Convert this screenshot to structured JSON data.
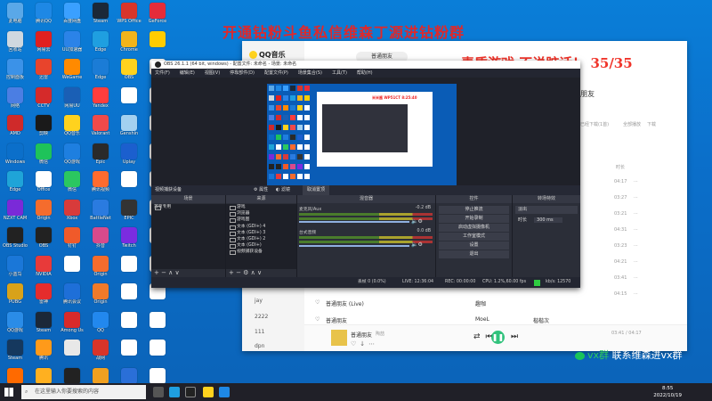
{
  "desktop_icons": [
    {
      "label": "此电脑",
      "color": "#5aa8e8"
    },
    {
      "label": "腾讯QQ",
      "color": "#1e88e5"
    },
    {
      "label": "百度网盘",
      "color": "#3aa0ff"
    },
    {
      "label": "Steam",
      "color": "#1b2838"
    },
    {
      "label": "WPS Office",
      "color": "#d8352a"
    },
    {
      "label": "GeForce",
      "color": "#e52c3a"
    },
    {
      "label": "回收站",
      "color": "#cfd8e0"
    },
    {
      "label": "网易云",
      "color": "#e02020"
    },
    {
      "label": "UU加速器",
      "color": "#2b83e8"
    },
    {
      "label": "Edge",
      "color": "#1f9fe0"
    },
    {
      "label": "Chrome",
      "color": "#f2b41a"
    },
    {
      "label": "",
      "color": "#ffcc00"
    },
    {
      "label": "控制面板",
      "color": "#3b92e8"
    },
    {
      "label": "迅雷",
      "color": "#e8442c"
    },
    {
      "label": "WeGame",
      "color": "#ff8a00"
    },
    {
      "label": "Edge",
      "color": "#1b7cd6"
    },
    {
      "label": "OBS",
      "color": "#ffd21e"
    },
    {
      "label": "",
      "color": "#ffffff"
    },
    {
      "label": "网络",
      "color": "#4b7ee3"
    },
    {
      "label": "CCTV",
      "color": "#d52a2a"
    },
    {
      "label": "网易UU",
      "color": "#1a5fb5"
    },
    {
      "label": "Yandex",
      "color": "#ff3d3d"
    },
    {
      "label": "",
      "color": "#ffffff"
    },
    {
      "label": "",
      "color": "#ffffff"
    },
    {
      "label": "AMD",
      "color": "#cf2a2a"
    },
    {
      "label": "剪映",
      "color": "#1a1a1a"
    },
    {
      "label": "QQ音乐",
      "color": "#ffd21e"
    },
    {
      "label": "Valorant",
      "color": "#f04a4a"
    },
    {
      "label": "Genshin",
      "color": "#a3d0f0"
    },
    {
      "label": "",
      "color": "#ffffff"
    },
    {
      "label": "Windows",
      "color": "#0b6fca"
    },
    {
      "label": "微信",
      "color": "#1ec35a"
    },
    {
      "label": "QQ游戏",
      "color": "#1e7fe0"
    },
    {
      "label": "Epic",
      "color": "#2a2a2a"
    },
    {
      "label": "Uplay",
      "color": "#1b5fce"
    },
    {
      "label": "",
      "color": "#ffffff"
    },
    {
      "label": "Edge",
      "color": "#1fa4d8"
    },
    {
      "label": "Office",
      "color": "#ffffff"
    },
    {
      "label": "微信",
      "color": "#2bc760"
    },
    {
      "label": "腾讯视频",
      "color": "#ff6b2e"
    },
    {
      "label": "",
      "color": "#ffffff"
    },
    {
      "label": "",
      "color": "#ffffff"
    },
    {
      "label": "NZXT CAM",
      "color": "#7a2ad8"
    },
    {
      "label": "Origin",
      "color": "#f56c2d"
    },
    {
      "label": "Xbox",
      "color": "#d83b3b"
    },
    {
      "label": "BattleNet",
      "color": "#2a7be0"
    },
    {
      "label": "EPIC",
      "color": "#333333"
    },
    {
      "label": "",
      "color": "#ffffff"
    },
    {
      "label": "OBS Studio",
      "color": "#222222"
    },
    {
      "label": "OBS",
      "color": "#222222"
    },
    {
      "label": "钉钉",
      "color": "#f05a2a"
    },
    {
      "label": "抖音",
      "color": "#d84a8c"
    },
    {
      "label": "Twitch",
      "color": "#7b2ce0"
    },
    {
      "label": "",
      "color": "#ffffff"
    },
    {
      "label": "小蓝鸟",
      "color": "#1a77d8"
    },
    {
      "label": "NVIDIA",
      "color": "#e83a3a"
    },
    {
      "label": "",
      "color": "#ffffff"
    },
    {
      "label": "Origin",
      "color": "#f56c2d"
    },
    {
      "label": "",
      "color": "#ffffff"
    },
    {
      "label": "",
      "color": "#ffffff"
    },
    {
      "label": "PUBG",
      "color": "#d8a21a"
    },
    {
      "label": "雷神",
      "color": "#e52c2c"
    },
    {
      "label": "腾讯会议",
      "color": "#1e6fd8"
    },
    {
      "label": "Origin",
      "color": "#f07a2a"
    },
    {
      "label": "",
      "color": "#ffffff"
    },
    {
      "label": "",
      "color": "#ffffff"
    },
    {
      "label": "QQ游戏",
      "color": "#2a8ce8"
    },
    {
      "label": "Steam",
      "color": "#1b2838"
    },
    {
      "label": "Among Us",
      "color": "#d82a2a"
    },
    {
      "label": "QQ",
      "color": "#2288ee"
    },
    {
      "label": "",
      "color": "#ffffff"
    },
    {
      "label": "",
      "color": "#ffffff"
    },
    {
      "label": "Steam",
      "color": "#15385e"
    },
    {
      "label": "腾讯",
      "color": "#ff9a1a"
    },
    {
      "label": "",
      "color": "#e8e8e8"
    },
    {
      "label": "战网",
      "color": "#d8342a"
    },
    {
      "label": "",
      "color": "#ffffff"
    },
    {
      "label": "",
      "color": "#ffffff"
    },
    {
      "label": "暴雪",
      "color": "#ff6a00"
    },
    {
      "label": "WeGame",
      "color": "#ffb020"
    },
    {
      "label": "",
      "color": "#222222"
    },
    {
      "label": "",
      "color": "#f0a020"
    },
    {
      "label": "TeamSpeak",
      "color": "#2a6fd8"
    },
    {
      "label": "",
      "color": "#ffffff"
    }
  ],
  "banner": {
    "line1": "开通钻粉斗鱼私信维森丁源进钻粉群",
    "line2": "素质游戏 不说脏话！ 35/35"
  },
  "qq": {
    "logo": "QQ音乐",
    "tab": "普通朋友",
    "right_header": "朋友",
    "sidebar": [
      "jay",
      "2222",
      "111",
      "dpn"
    ],
    "header_right": [
      "已经下载(1首)",
      "全部播放",
      "下载"
    ],
    "col_time": "时长",
    "rows": [
      {
        "title": "普通朋友 (Live)",
        "artist": "趣咖",
        "time": "03:41"
      },
      {
        "title": "普通朋友",
        "artist": "MoeL",
        "album": "楷楷次",
        "time": "04:17"
      }
    ],
    "times": [
      "04:17",
      "03:27",
      "03:21",
      "04:31",
      "03:23",
      "04:21",
      "03:41",
      "04:15"
    ],
    "player": {
      "title": "普通朋友",
      "sub": "陶喆",
      "progress": "03:41 / 04:17"
    }
  },
  "obs": {
    "title": "OBS 26.1.1 (64 bit, windows) - 配置文件: 未命名 - 场景: 未命名",
    "menu": [
      "文件(F)",
      "编辑(E)",
      "视图(V)",
      "停靠部件(D)",
      "配置文件(P)",
      "场景集合(S)",
      "工具(T)",
      "帮助(H)"
    ],
    "source_line": [
      "视频捕获设备",
      "属性",
      "滤镜",
      "取消置顶"
    ],
    "scenes_h": "场景",
    "scenes": [
      "首页专用"
    ],
    "sources_h": "来源",
    "sources": [
      "游戏",
      "浏览器",
      "游戏图",
      "文本 (GDI+) 4",
      "文本 (GDI+) 3",
      "文本 (GDI+) 2",
      "文本 (GDI+)",
      "视频捕获设备"
    ],
    "mixer_h": "混音器",
    "ch1": "麦克风/Aux",
    "ch1_db": "-0.2 dB",
    "ch2": "台式音频",
    "ch2_db": "0.0 dB",
    "controls_h": "控件",
    "controls": [
      "停止推流",
      "开始录制",
      "启动虚拟摄像机",
      "工作室模式",
      "设置",
      "退出"
    ],
    "trans_h": "转场特效",
    "trans": "淡出",
    "dur_label": "时长",
    "dur": "300 ms",
    "status": [
      "丢帧 0 (0.0%)",
      "LIVE: 12:36:04",
      "REC: 00:00:00",
      "CPU: 1.2%,60.00 fps",
      "kb/s: 12570"
    ],
    "preview_text": "米米酱 WP51CT 8:25:40"
  },
  "taskbar": {
    "search": "在这里输入你要搜索的内容",
    "time": "8:55",
    "date": "2022/10/19"
  },
  "wechat": {
    "prefix": "vx群",
    "text": "联系维森进vx群"
  }
}
